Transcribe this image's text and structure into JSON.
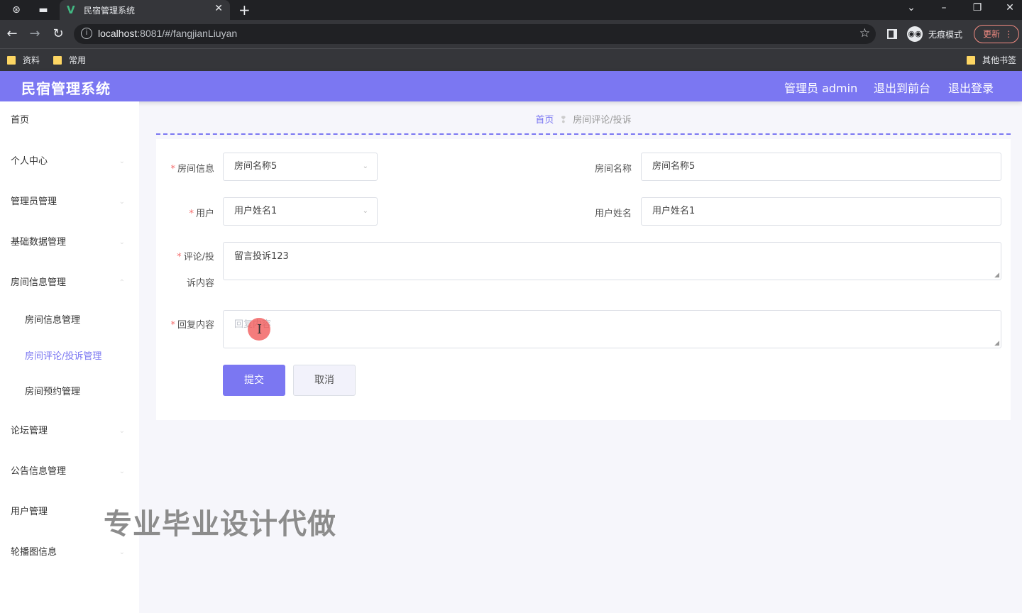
{
  "browser": {
    "tab_title": "民宿管理系统",
    "url_host": "localhost",
    "url_rest": ":8081/#/fangjianLiuyan",
    "incognito_label": "无痕模式",
    "update_label": "更新",
    "bookmarks": [
      "资料",
      "常用"
    ],
    "other_bookmarks": "其他书签"
  },
  "header": {
    "title": "民宿管理系统",
    "admin_label": "管理员 admin",
    "front_label": "退出到前台",
    "logout_label": "退出登录"
  },
  "sidebar": {
    "items": [
      {
        "label": "首页"
      },
      {
        "label": "个人中心"
      },
      {
        "label": "管理员管理"
      },
      {
        "label": "基础数据管理"
      },
      {
        "label": "房间信息管理"
      },
      {
        "label": "房间信息管理"
      },
      {
        "label": "房间评论/投诉管理"
      },
      {
        "label": "房间预约管理"
      },
      {
        "label": "论坛管理"
      },
      {
        "label": "公告信息管理"
      },
      {
        "label": "用户管理"
      },
      {
        "label": "轮播图信息"
      }
    ]
  },
  "breadcrumb": {
    "home": "首页",
    "current": "房间评论/投诉"
  },
  "form": {
    "room_info_label": "房间信息",
    "room_info_value": "房间名称5",
    "room_name_label": "房间名称",
    "room_name_value": "房间名称5",
    "user_label": "用户",
    "user_value": "用户姓名1",
    "user_name_label": "用户姓名",
    "user_name_value": "用户姓名1",
    "comment_label_1": "评论/投",
    "comment_label_2": "诉内容",
    "comment_value": "留言投诉123",
    "reply_label": "回复内容",
    "reply_placeholder": "回复内容",
    "submit_label": "提交",
    "cancel_label": "取消"
  },
  "overlay": {
    "watermark": "专业毕业设计代做"
  },
  "colors": {
    "accent": "#7b77f2",
    "required": "#f56c6c"
  }
}
